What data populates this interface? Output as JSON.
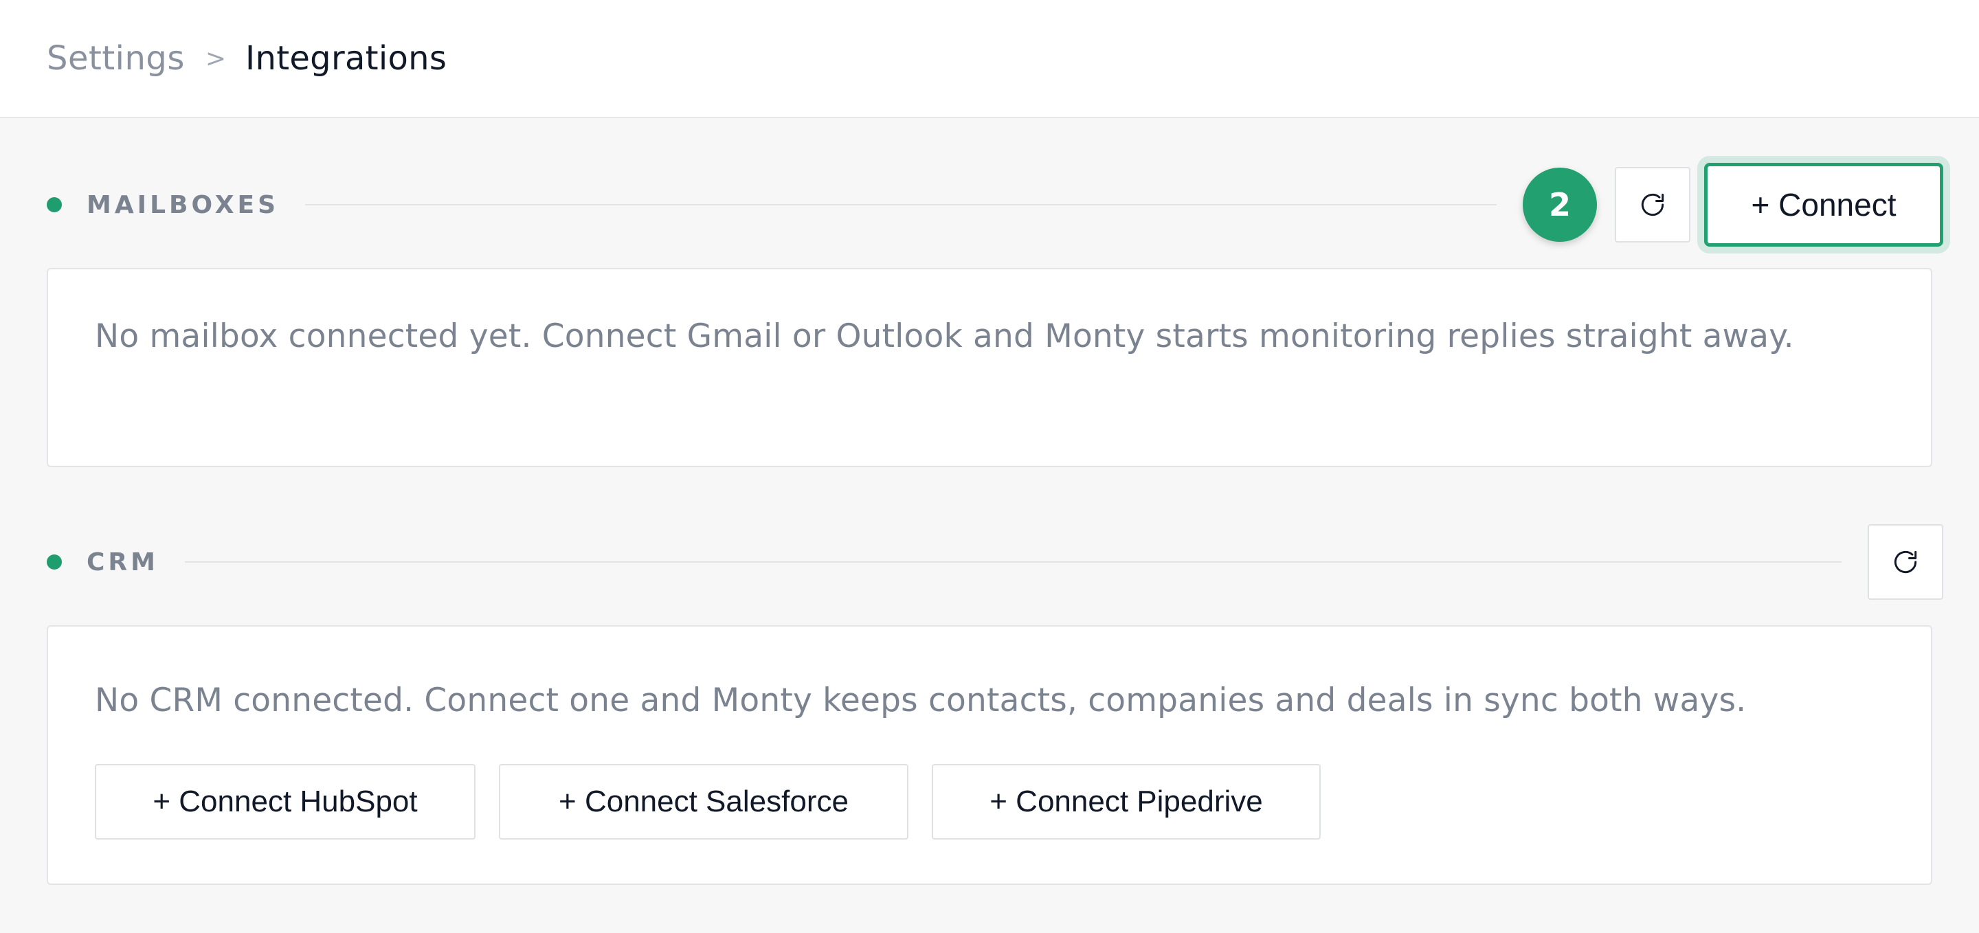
{
  "breadcrumb": {
    "parent": "Settings",
    "separator": ">",
    "current": "Integrations"
  },
  "mailboxes": {
    "label": "MAILBOXES",
    "count": "2",
    "refresh_icon": "refresh-icon",
    "connect_label": "+ Connect",
    "empty_text": "No mailbox connected yet. Connect Gmail or Outlook and Monty starts monitoring replies straight away."
  },
  "crm": {
    "label": "CRM",
    "refresh_icon": "refresh-icon",
    "empty_text": "No CRM connected. Connect one and Monty keeps contacts, companies and deals in sync both ways.",
    "buttons": [
      {
        "label": "+ Connect HubSpot"
      },
      {
        "label": "+ Connect Salesforce"
      },
      {
        "label": "+ Connect Pipedrive"
      }
    ]
  },
  "colors": {
    "accent": "#22a06f",
    "muted_text": "#7b8391",
    "background": "#f7f7f7"
  }
}
